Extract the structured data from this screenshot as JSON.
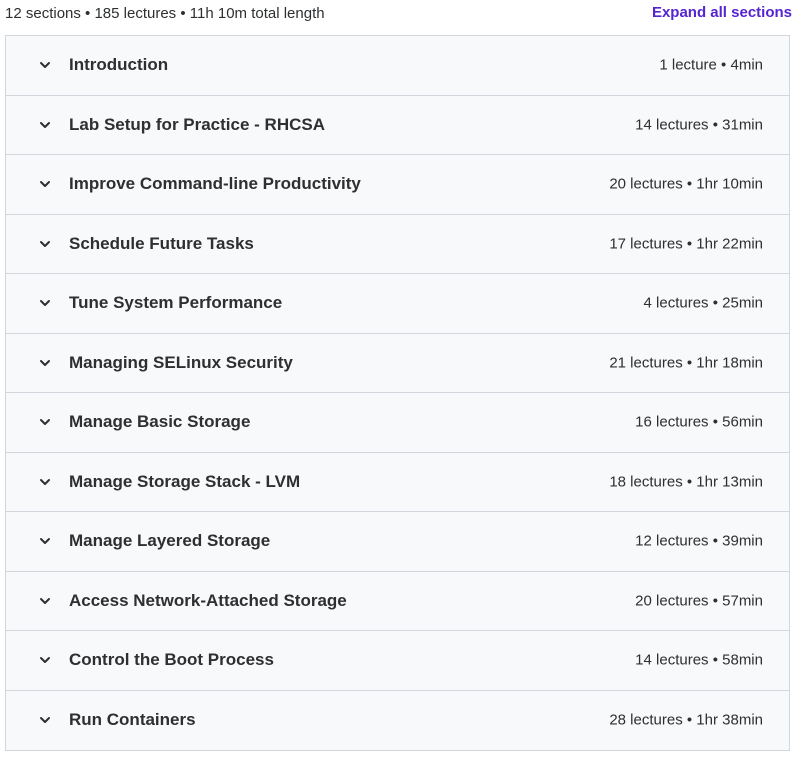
{
  "header": {
    "summary": "12 sections • 185 lectures • 11h 10m total length",
    "expand_all_label": "Expand all sections"
  },
  "icons": {
    "chevron": "chevron-down-icon"
  },
  "colors": {
    "accent": "#5624d0",
    "text": "#2d2f31",
    "section_bg": "#f7f9fa",
    "border": "#d1d7dc"
  },
  "sections": [
    {
      "title": "Introduction",
      "meta": "1 lecture • 4min"
    },
    {
      "title": "Lab Setup for Practice - RHCSA",
      "meta": "14 lectures • 31min"
    },
    {
      "title": "Improve Command-line Productivity",
      "meta": "20 lectures • 1hr 10min"
    },
    {
      "title": "Schedule Future Tasks",
      "meta": "17 lectures • 1hr 22min"
    },
    {
      "title": "Tune System Performance",
      "meta": "4 lectures • 25min"
    },
    {
      "title": "Managing SELinux Security",
      "meta": "21 lectures • 1hr 18min"
    },
    {
      "title": "Manage Basic Storage",
      "meta": "16 lectures • 56min"
    },
    {
      "title": "Manage Storage Stack - LVM",
      "meta": "18 lectures • 1hr 13min"
    },
    {
      "title": "Manage Layered Storage",
      "meta": "12 lectures • 39min"
    },
    {
      "title": "Access Network-Attached Storage",
      "meta": "20 lectures • 57min"
    },
    {
      "title": "Control the Boot Process",
      "meta": "14 lectures • 58min"
    },
    {
      "title": "Run Containers",
      "meta": "28 lectures • 1hr 38min"
    }
  ]
}
